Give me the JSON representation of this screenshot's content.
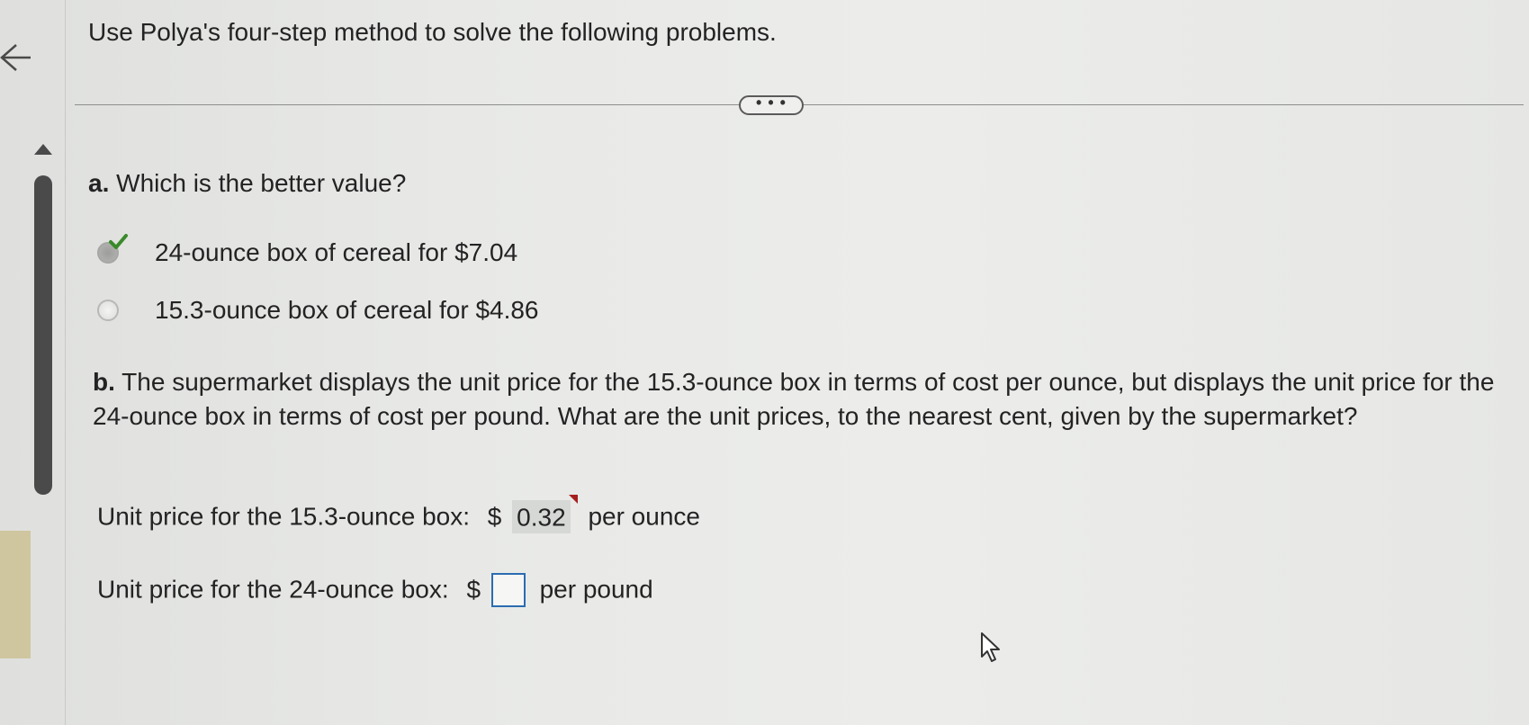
{
  "instructions": "Use Polya's four-step method to solve the following problems.",
  "more_button": "• • •",
  "part_a": {
    "label": "a.",
    "question": "Which is the better value?",
    "options": [
      {
        "text": "24-ounce box of cereal for $7.04",
        "selected": true,
        "correct": true
      },
      {
        "text": "15.3-ounce box of cereal for $4.86",
        "selected": false
      }
    ]
  },
  "part_b": {
    "label": "b.",
    "question": "The supermarket displays the unit price for the 15.3-ounce box in terms of cost per ounce, but displays the unit price for the 24-ounce box in terms of cost per pound. What are the unit prices, to the nearest cent, given by the supermarket?",
    "answers": [
      {
        "label": "Unit price for the 15.3-ounce box:",
        "currency": "$",
        "value": "0.32",
        "unit": "per ounce"
      },
      {
        "label": "Unit price for the 24-ounce box:",
        "currency": "$",
        "value": "",
        "unit": "per pound"
      }
    ]
  },
  "colors": {
    "check": "#3a8a2a",
    "incorrect_flag": "#a42020",
    "input_border": "#2b6cb0"
  }
}
